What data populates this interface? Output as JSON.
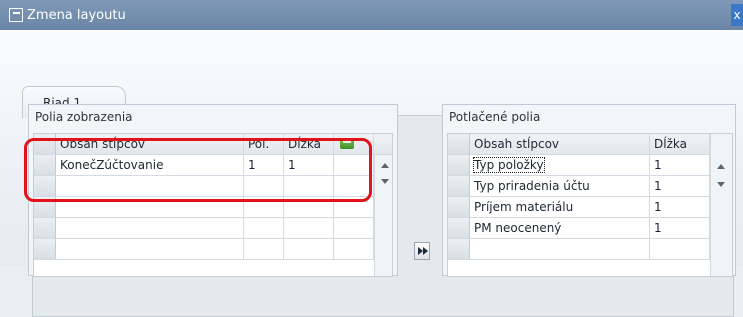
{
  "window": {
    "title": "Zmena layoutu",
    "close_label": "x"
  },
  "tabs": [
    {
      "label": "Riad.1"
    }
  ],
  "left_panel": {
    "title": "Polia zobrazenia",
    "columns": [
      "Obsah stĺpcov",
      "Pol.",
      "Dĺžka"
    ],
    "rows": [
      {
        "content": "KonečZúčtovanie",
        "pol": "1",
        "dlzka": "1"
      }
    ]
  },
  "right_panel": {
    "title": "Potlačené polia",
    "columns": [
      "Obsah stĺpcov",
      "Dĺžka"
    ],
    "rows": [
      {
        "content": "Typ položky",
        "dlzka": "1"
      },
      {
        "content": "Typ priradenia účtu",
        "dlzka": "1"
      },
      {
        "content": "Príjem materiálu",
        "dlzka": "1"
      },
      {
        "content": "PM neocenený",
        "dlzka": "1"
      }
    ]
  },
  "icons": {
    "title_icon": "window-icon",
    "column_settings": "column-settings-icon",
    "move": "move-right-icon"
  }
}
